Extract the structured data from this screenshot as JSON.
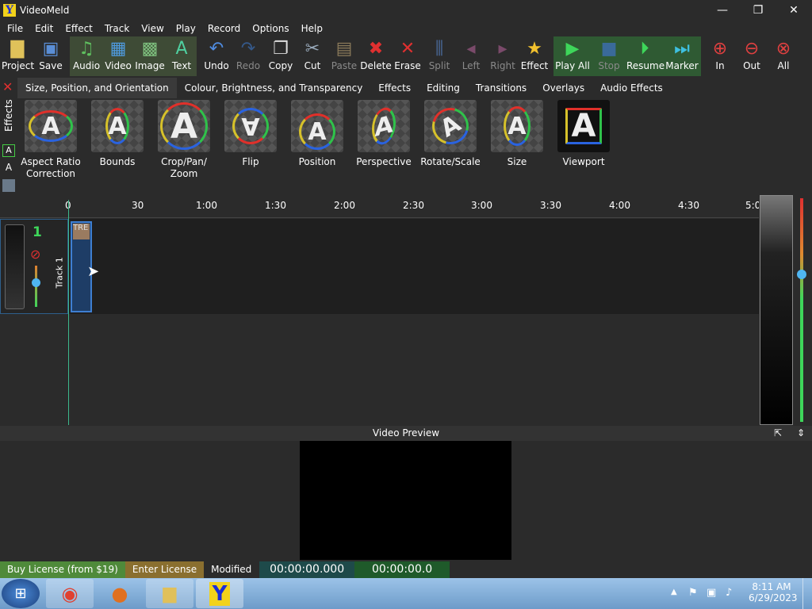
{
  "window": {
    "title": "VideoMeld",
    "minimize": "—",
    "restore": "❐",
    "close": "✕"
  },
  "menu": [
    "File",
    "Edit",
    "Effect",
    "Track",
    "View",
    "Play",
    "Record",
    "Options",
    "Help"
  ],
  "toolbar": {
    "project": "Project",
    "save": "Save",
    "audio": "Audio",
    "video": "Video",
    "image": "Image",
    "text": "Text",
    "undo": "Undo",
    "redo": "Redo",
    "copy": "Copy",
    "cut": "Cut",
    "paste": "Paste",
    "delete": "Delete",
    "erase": "Erase",
    "split": "Split",
    "left": "Left",
    "right": "Right",
    "effect": "Effect",
    "play_all": "Play All",
    "stop": "Stop",
    "resume": "Resume",
    "marker": "Marker",
    "zoom_in": "In",
    "zoom_out": "Out",
    "zoom_all": "All"
  },
  "effects_strip": {
    "label": "Effects"
  },
  "tabs": [
    "Size, Position, and Orientation",
    "Colour, Brightness, and Transparency",
    "Effects",
    "Editing",
    "Transitions",
    "Overlays",
    "Audio Effects"
  ],
  "effects": [
    {
      "label": "Aspect Ratio Correction"
    },
    {
      "label": "Bounds"
    },
    {
      "label": "Crop/Pan/ Zoom"
    },
    {
      "label": "Flip"
    },
    {
      "label": "Position"
    },
    {
      "label": "Perspective"
    },
    {
      "label": "Rotate/Scale"
    },
    {
      "label": "Size"
    },
    {
      "label": "Viewport"
    }
  ],
  "ruler": [
    "0",
    "30",
    "1:00",
    "1:30",
    "2:00",
    "2:30",
    "3:00",
    "3:30",
    "4:00",
    "4:30",
    "5:0"
  ],
  "track": {
    "number": "1",
    "name": "Track 1",
    "clip_label": "TRE"
  },
  "preview": {
    "title": "Video Preview"
  },
  "status": {
    "buy": "Buy License (from $19)",
    "enter": "Enter License",
    "modified": "Modified",
    "time1": "00:00:00.000",
    "time2": "00:00:00.0"
  },
  "taskbar": {
    "time": "8:11 AM",
    "date": "6/29/2023"
  },
  "colors": {
    "bg": "#2b2b2b",
    "buy_bg": "#4f8a3a",
    "enter_bg": "#8a6f2f",
    "time1_bg": "#1e4a4a",
    "time2_bg": "#1f5a2a"
  }
}
